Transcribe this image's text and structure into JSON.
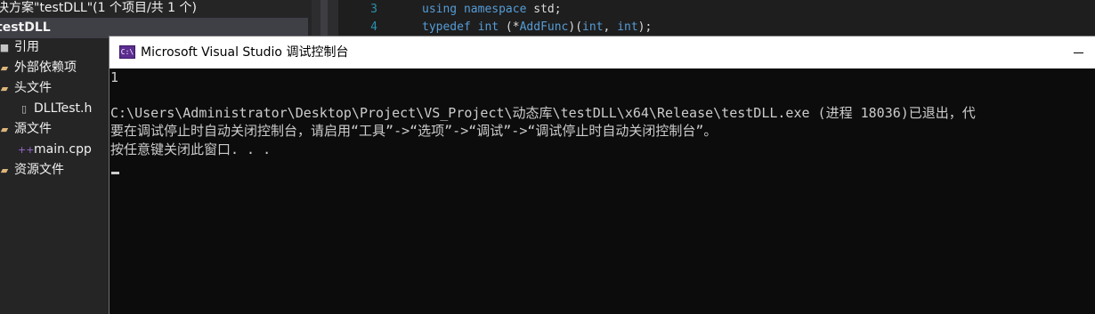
{
  "solution_explorer": {
    "title": "决方案\"testDLL\"(1 个项目/共 1 个)",
    "project": "testDLL",
    "items": [
      {
        "label": "引用",
        "icon": "references-icon"
      },
      {
        "label": "外部依赖项",
        "icon": "folder-icon"
      },
      {
        "label": "头文件",
        "icon": "folder-icon"
      },
      {
        "label": "DLLTest.h",
        "icon": "header-file-icon"
      },
      {
        "label": "源文件",
        "icon": "folder-icon"
      },
      {
        "label": "main.cpp",
        "icon": "cpp-file-icon"
      },
      {
        "label": "资源文件",
        "icon": "folder-icon"
      }
    ]
  },
  "editor": {
    "lines": [
      {
        "number": "3",
        "kw1": "using",
        "kw2": "namespace",
        "rest": " std;"
      },
      {
        "number": "4",
        "kw1": "typedef",
        "kw2": "int",
        "rest1": " (*",
        "fn": "AddFunc",
        "rest2": ")(",
        "kw3": "int",
        "rest3": ", ",
        "kw4": "int",
        "rest4": ");"
      }
    ]
  },
  "console": {
    "window_title": "Microsoft Visual Studio 调试控制台",
    "icon_text": "C:\\",
    "lines": [
      "1",
      "",
      "C:\\Users\\Administrator\\Desktop\\Project\\VS_Project\\动态库\\testDLL\\x64\\Release\\testDLL.exe (进程 18036)已退出，代",
      "要在调试停止时自动关闭控制台，请启用“工具”->“选项”->“调试”->“调试停止时自动关闭控制台”。",
      "按任意键关闭此窗口. . ."
    ]
  },
  "colors": {
    "console_bg": "#0c0c0c",
    "console_text": "#cccccc",
    "keyword": "#569cd6",
    "line_number": "#2b91af",
    "explorer_bg": "#252526"
  }
}
